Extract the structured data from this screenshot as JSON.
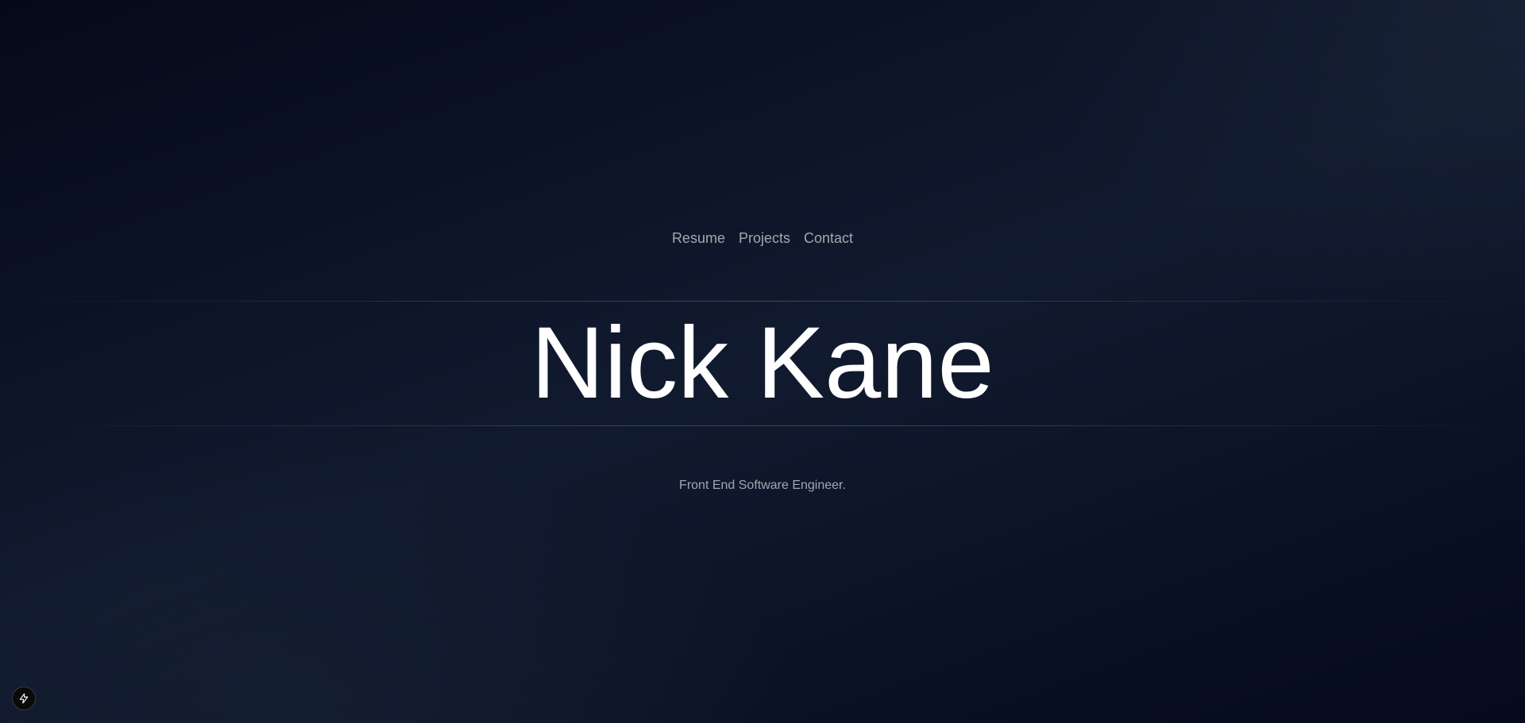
{
  "nav": {
    "links": [
      {
        "label": "Resume"
      },
      {
        "label": "Projects"
      },
      {
        "label": "Contact"
      }
    ]
  },
  "hero": {
    "name": "Nick Kane",
    "tagline": "Front End Software Engineer."
  },
  "dev_indicator": {
    "icon": "lightning-bolt-icon"
  },
  "colors": {
    "background": "#0b1224",
    "title": "#ffffff",
    "muted_text": "#a3a7ad",
    "divider": "#71717a"
  }
}
